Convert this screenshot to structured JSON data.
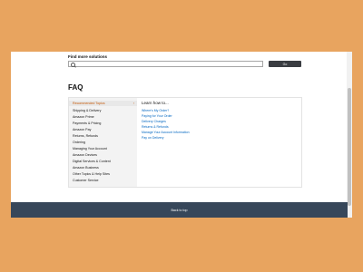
{
  "search": {
    "label": "Find more solutions",
    "placeholder": "",
    "button_label": "Go"
  },
  "faq": {
    "title": "FAQ",
    "topics": [
      "Recommended Topics",
      "Shipping & Delivery",
      "Amazon Prime",
      "Payments & Pricing",
      "Amazon Pay",
      "Returns, Refunds",
      "Ordering",
      "Managing Your Account",
      "Amazon Devices",
      "Digital Services & Content",
      "Amazon Business",
      "Other Topics & Help Sites",
      "Customer Service"
    ],
    "active_chevron": "›",
    "learn_heading": "Learn how to...",
    "links": [
      "Where's My Order?",
      "Paying for Your Order",
      "Delivery Charges",
      "Returns & Refunds",
      "Manage Your Account Information",
      "Pay on Delivery"
    ]
  },
  "footer": {
    "back_to_top": "Back to top"
  }
}
